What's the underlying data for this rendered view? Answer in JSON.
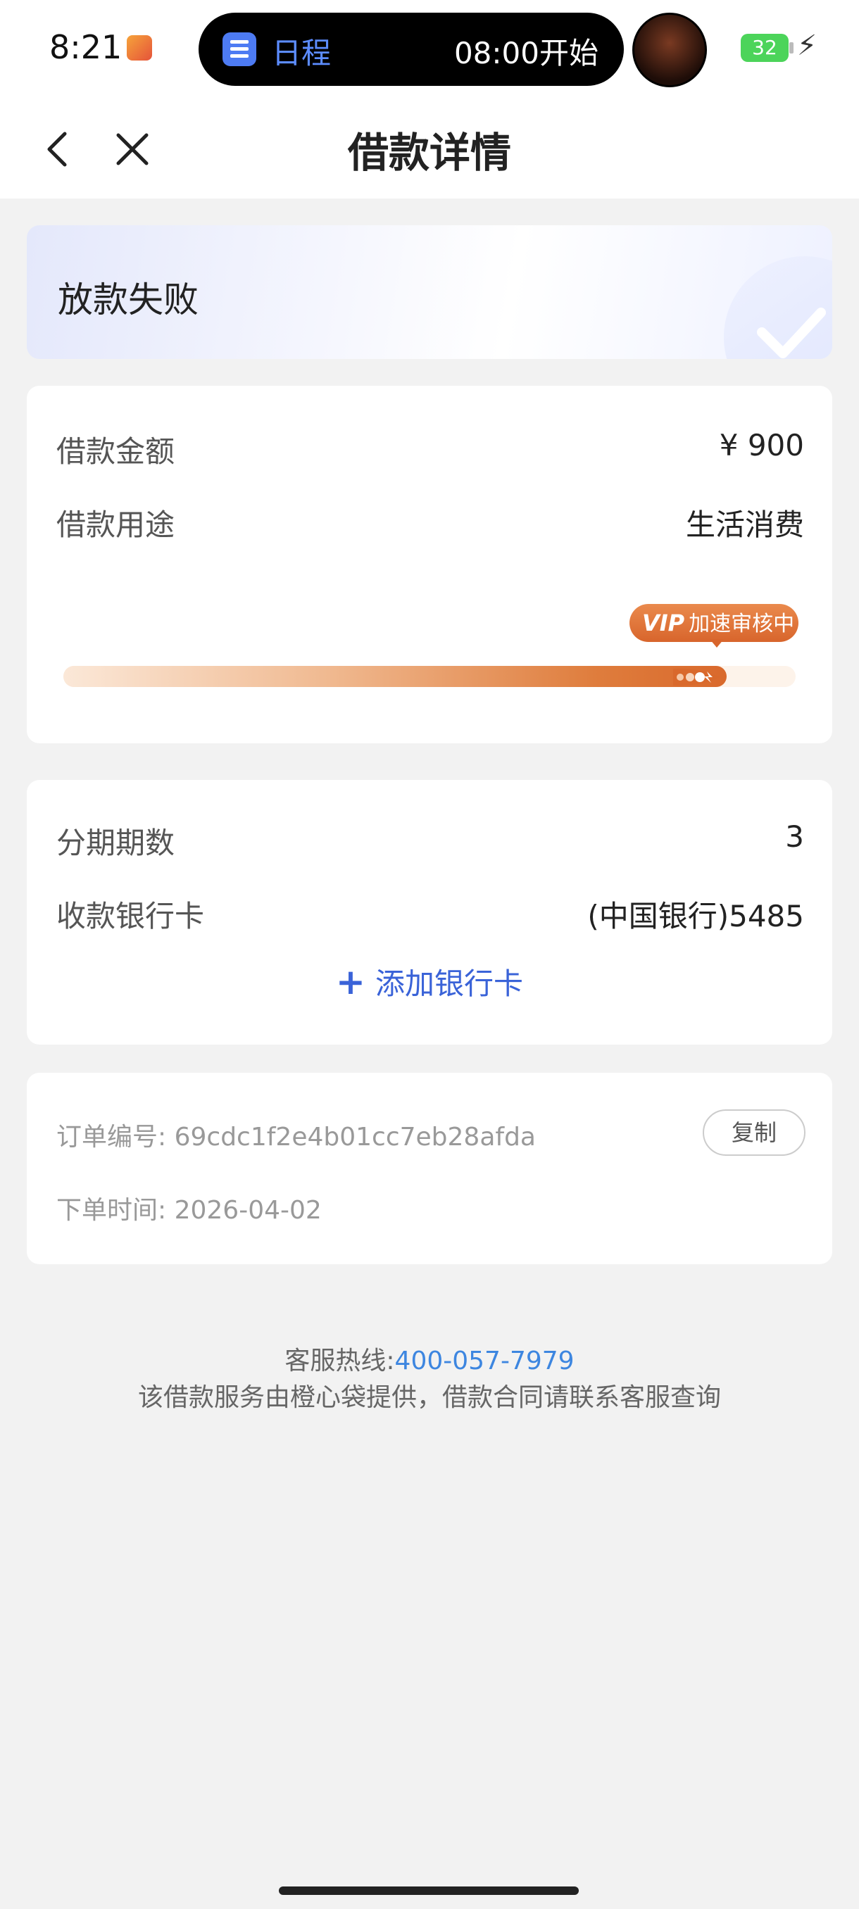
{
  "status_bar": {
    "time": "8:21",
    "island_label": "日程",
    "island_time": "08:00开始",
    "battery": "32"
  },
  "nav": {
    "title": "借款详情"
  },
  "status": {
    "text": "放款失败"
  },
  "loan": {
    "amount_label": "借款金额",
    "amount_value": "¥ 900",
    "purpose_label": "借款用途",
    "purpose_value": "生活消费",
    "badge_vip": "VIP",
    "badge_text": "加速审核中",
    "progress": 0.92
  },
  "installment": {
    "periods_label": "分期期数",
    "periods_value": "3",
    "card_label": "收款银行卡",
    "card_value": "(中国银行)5485",
    "add_card": "添加银行卡"
  },
  "order": {
    "number_label": "订单编号:",
    "number_value": "69cdc1f2e4b01cc7eb28afda",
    "copy_label": "复制",
    "time_label": "下单时间:",
    "time_value": "2026-04-02"
  },
  "footer": {
    "hotline_label": "客服热线:",
    "hotline_number": "400-057-7979",
    "notice": "该借款服务由橙心袋提供，借款合同请联系客服查询"
  },
  "colors": {
    "accent_blue": "#3a63d8",
    "progress_orange": "#d9692c",
    "hotline_blue": "#3d86e0"
  }
}
